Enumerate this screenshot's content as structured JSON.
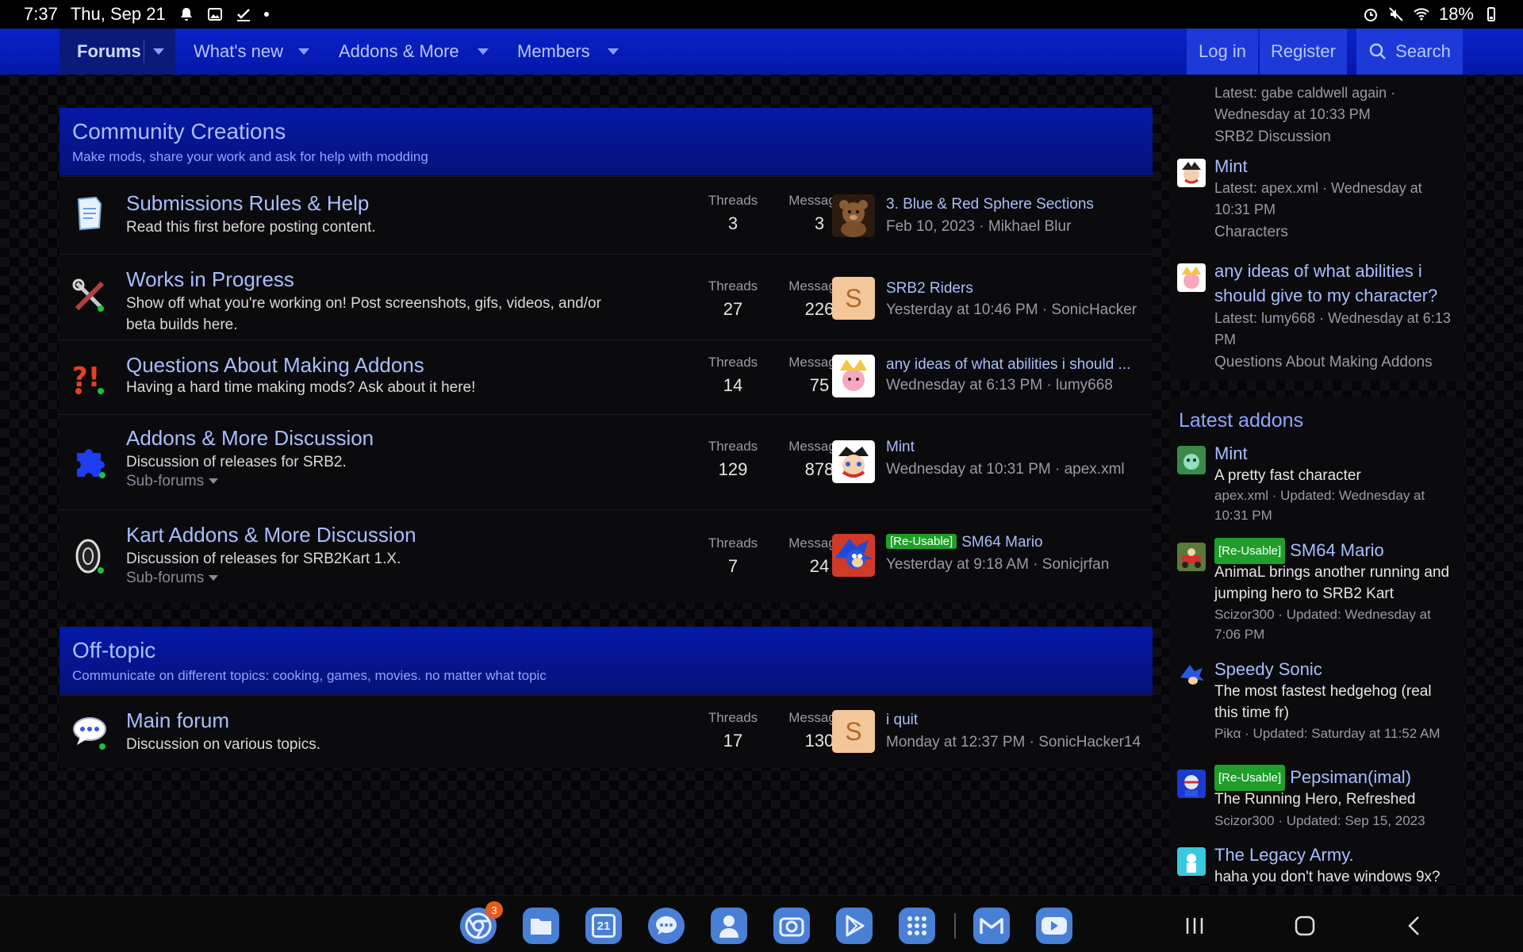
{
  "status_bar": {
    "time": "7:37",
    "date": "Thu, Sep 21",
    "battery": "18%"
  },
  "nav": {
    "items": [
      {
        "label": "Forums"
      },
      {
        "label": "What's new"
      },
      {
        "label": "Addons & More"
      },
      {
        "label": "Members"
      }
    ],
    "login": "Log in",
    "register": "Register",
    "search": "Search"
  },
  "sections": [
    {
      "title": "Community Creations",
      "description": "Make mods, share your work and ask for help with modding",
      "nodes": [
        {
          "title": "Submissions Rules & Help",
          "description": "Read this first before posting content.",
          "threads_label": "Threads",
          "threads": "3",
          "messages_label": "Messages",
          "messages": "3",
          "last_title": "3. Blue & Red Sphere Sections",
          "last_meta": "Feb 10, 2023 · Mikhael Blur"
        },
        {
          "title": "Works in Progress",
          "description": "Show off what you're working on! Post screenshots, gifs, videos, and/or beta builds here.",
          "threads_label": "Threads",
          "threads": "27",
          "messages_label": "Messages",
          "messages": "226",
          "last_title": "SRB2 Riders",
          "last_meta": "Yesterday at 10:46 PM · SonicHacker",
          "avatar_letter": "S"
        },
        {
          "title": "Questions About Making Addons",
          "description": "Having a hard time making mods? Ask about it here!",
          "threads_label": "Threads",
          "threads": "14",
          "messages_label": "Messages",
          "messages": "75",
          "last_title": "any ideas of what abilities i should ...",
          "last_meta": "Wednesday at 6:13 PM · lumy668"
        },
        {
          "title": "Addons & More Discussion",
          "description": "Discussion of releases for SRB2.",
          "subforums": "Sub-forums",
          "threads_label": "Threads",
          "threads": "129",
          "messages_label": "Messages",
          "messages": "878",
          "last_title": "Mint",
          "last_meta": "Wednesday at 10:31 PM · apex.xml"
        },
        {
          "title": "Kart Addons & More Discussion",
          "description": "Discussion of releases for SRB2Kart 1.X.",
          "subforums": "Sub-forums",
          "threads_label": "Threads",
          "threads": "7",
          "messages_label": "Messages",
          "messages": "24",
          "last_tag": "[Re-Usable]",
          "last_title": "SM64 Mario",
          "last_meta": "Yesterday at 9:18 AM · Sonicjrfan"
        }
      ]
    },
    {
      "title": "Off-topic",
      "description": "Communicate on different topics: cooking, games, movies. no matter what topic",
      "nodes": [
        {
          "title": "Main forum",
          "description": "Discussion on various topics.",
          "threads_label": "Threads",
          "threads": "17",
          "messages_label": "Messages",
          "messages": "130",
          "last_title": "i quit",
          "last_meta": "Monday at 12:37 PM · SonicHacker14",
          "avatar_letter": "S"
        }
      ]
    }
  ],
  "sidebar": {
    "latest_posts": [
      {
        "meta": "Latest: gabe caldwell again · Wednesday at 10:33 PM",
        "forum": "SRB2 Discussion"
      },
      {
        "title": "Mint",
        "meta": "Latest: apex.xml · Wednesday at 10:31 PM",
        "forum": "Characters"
      },
      {
        "title": "any ideas of what abilities i should give to my character?",
        "meta": "Latest: lumy668 · Wednesday at 6:13 PM",
        "forum": "Questions About Making Addons"
      }
    ],
    "latest_addons_heading": "Latest addons",
    "latest_addons": [
      {
        "title": "Mint",
        "text": "A pretty fast character",
        "meta": "apex.xml · Updated: Wednesday at 10:31 PM"
      },
      {
        "tag": "[Re-Usable]",
        "title": "SM64 Mario",
        "text": "AnimaL brings another running and jumping hero to SRB2 Kart",
        "meta": "Scizor300 · Updated: Wednesday at 7:06 PM"
      },
      {
        "title": "Speedy Sonic",
        "text": "The most fastest hedgehog (real this time fr)",
        "meta": "Pikα · Updated: Saturday at 11:52 AM"
      },
      {
        "tag": "[Re-Usable]",
        "title": "Pepsiman(imal)",
        "text": "The Running Hero, Refreshed",
        "meta": "Scizor300 · Updated: Sep 15, 2023"
      },
      {
        "title": "The Legacy Army.",
        "text": "haha you don't have windows 9x?"
      }
    ]
  },
  "dock": {
    "badge_count": "3",
    "calendar_day": "21"
  }
}
